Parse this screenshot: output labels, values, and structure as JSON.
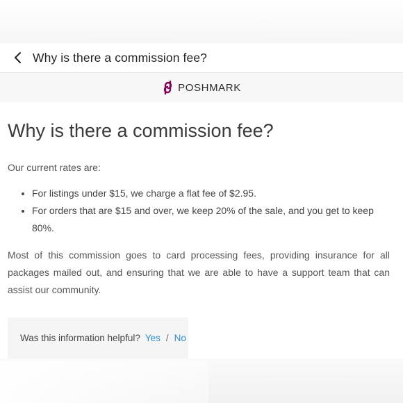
{
  "nav": {
    "back_icon": "chevron-left-icon",
    "title": "Why is there a commission fee?"
  },
  "brand": {
    "logo_icon": "poshmark-logo-icon",
    "name": "POSHMARK",
    "logo_color": "#7f0353"
  },
  "article": {
    "heading": "Why is there a commission fee?",
    "intro": "Our current rates are:",
    "rates": [
      "For listings under $15, we charge a flat fee of $2.95.",
      "For orders that are $15 and over, we keep 20% of the sale, and you get to keep 80%."
    ],
    "explanation": "Most of this commission goes to card processing fees, providing insurance for all packages mailed out, and ensuring that we are able to have a support team that can assist our community."
  },
  "feedback": {
    "question": "Was this information helpful?",
    "yes_label": "Yes",
    "separator": "/",
    "no_label": "No",
    "link_color": "#2e8fd6"
  }
}
